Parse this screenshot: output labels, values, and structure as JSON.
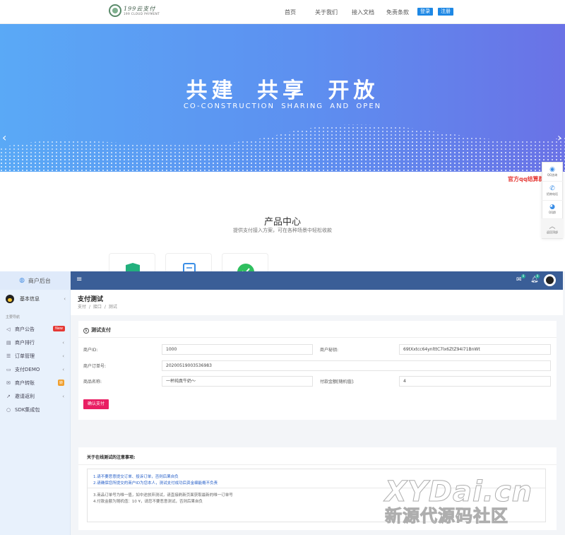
{
  "site": {
    "logo_line1": "199云支付",
    "logo_line2": "199 CLOUD PAYMENT",
    "nav": [
      "首页",
      "关于我们",
      "接入文档",
      "免责条款"
    ],
    "login": "登录",
    "register": "注册"
  },
  "banner": {
    "title": "共建 共享 开放",
    "subtitle": "CO-CONSTRUCTION SHARING AND OPEN",
    "prev": "‹",
    "next": "›"
  },
  "qq_promo": "官方qq结算群",
  "float_bar": [
    {
      "icon": "qq-consult-icon",
      "glyph": "◉",
      "label": "QQ咨询"
    },
    {
      "icon": "phone-icon",
      "glyph": "✆",
      "label": "招商电话"
    },
    {
      "icon": "qq-group-icon",
      "glyph": "◕",
      "label": "QQ群"
    },
    {
      "icon": "back-to-top-icon",
      "glyph": "︿",
      "label": "返回顶部"
    }
  ],
  "products": {
    "title": "产品中心",
    "desc": "提供支付接入方案，可在各种场景中轻松收款"
  },
  "admin": {
    "brand": "商户后台",
    "user": "基本信息",
    "section": "主要导航",
    "menu": [
      {
        "icon": "announce-icon",
        "glyph": "◁",
        "label": "商户公告",
        "badge": "New"
      },
      {
        "icon": "rank-icon",
        "glyph": "▤",
        "label": "商户排行",
        "right": "‹"
      },
      {
        "icon": "order-icon",
        "glyph": "☰",
        "label": "订单管理",
        "right": "‹"
      },
      {
        "icon": "demo-icon",
        "glyph": "▭",
        "label": "支付DEMO",
        "right": "‹"
      },
      {
        "icon": "transfer-icon",
        "glyph": "✉",
        "label": "商户转账",
        "badge": "转"
      },
      {
        "icon": "invite-icon",
        "glyph": "↗",
        "label": "邀请返利",
        "right": "‹"
      },
      {
        "icon": "sdk-icon",
        "glyph": "○",
        "label": "SDK集成包"
      }
    ],
    "topbar": {
      "mail_count": "0",
      "bell_count": "0"
    },
    "page_title": "支付测试",
    "breadcrumb": [
      "支付",
      "/",
      "接口",
      "/",
      "测试"
    ],
    "form": {
      "title": "测试支付",
      "merchant_id_label": "商户ID:",
      "merchant_id": "1000",
      "merchant_key_label": "商户秘钥:",
      "merchant_key": "69tXxtcc64ynlttC7lx6ZtZ94i71BnWt",
      "order_no_label": "商户订单号:",
      "order_no": "20200519003536983",
      "goods_label": "商品名称:",
      "goods": "一杯纯真牛奶～",
      "amount_label": "付款金额[随机值]:",
      "amount": "4",
      "submit": "确认支付"
    },
    "notice": {
      "title": "关于在线测试的注意事项:",
      "lines_blue": [
        "1.请不要恶意提交订单、投诉订单，否则后果自负",
        "2.请确保您所提交的商户ID为您本人，测试支付成功后资金编能概不负责"
      ],
      "lines_gray": [
        "3.商品订单号为唯一值，如中途放弃测试，请直接刷新页面获取最新的唯一订单号",
        "4.付款金额为随机值：10 ¥，请您不要恶意测试，否则后果自负"
      ]
    }
  },
  "watermark": {
    "line1": "XYDai.cn",
    "line2": "新源代源码社区"
  }
}
